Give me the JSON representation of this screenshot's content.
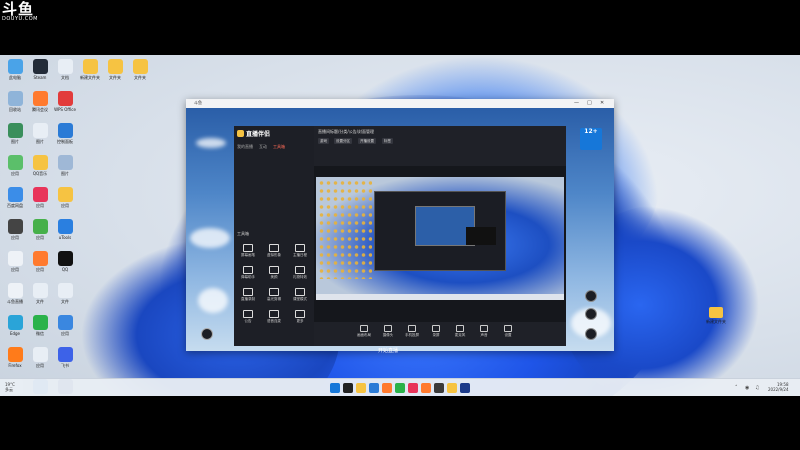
{
  "watermark": {
    "brand": "斗鱼",
    "url": "DOUYU.COM"
  },
  "desktop": {
    "icons": [
      {
        "label": "此电脑",
        "color": "#4aa3e8"
      },
      {
        "label": "Steam",
        "color": "#222b38"
      },
      {
        "label": "文档",
        "color": "#e8eef5"
      },
      {
        "label": "新建文件夹",
        "color": "#f6c342"
      },
      {
        "label": "文件夹",
        "color": "#f6c342"
      },
      {
        "label": "文件夹",
        "color": "#f6c342"
      },
      {
        "label": "回收站",
        "color": "#8fb4d9"
      },
      {
        "label": "腾讯会议",
        "color": "#ff7a2e"
      },
      {
        "label": "WPS Office",
        "color": "#e23b3b"
      },
      {
        "label": "图片",
        "color": "#3a8f5c"
      },
      {
        "label": "图片",
        "color": "#e8eef5"
      },
      {
        "label": "控制面板",
        "color": "#2b7bd6"
      },
      {
        "label": "应用",
        "color": "#5bbf6a"
      },
      {
        "label": "QQ音乐",
        "color": "#f6c342"
      },
      {
        "label": "图片",
        "color": "#9fb8d6"
      },
      {
        "label": "百度网盘",
        "color": "#3b8de8"
      },
      {
        "label": "应用",
        "color": "#e8345a"
      },
      {
        "label": "应用",
        "color": "#f6c342"
      },
      {
        "label": "应用",
        "color": "#444"
      },
      {
        "label": "应用",
        "color": "#46b04a"
      },
      {
        "label": "uTools",
        "color": "#2a7fe0"
      },
      {
        "label": "应用",
        "color": "#eef2f7"
      },
      {
        "label": "应用",
        "color": "#ff7a2e"
      },
      {
        "label": "QQ",
        "color": "#111"
      },
      {
        "label": "斗鱼直播",
        "color": "#eef2f7"
      },
      {
        "label": "文件",
        "color": "#e8eef5"
      },
      {
        "label": "文件",
        "color": "#e8eef5"
      },
      {
        "label": "Edge",
        "color": "#2aa4d8"
      },
      {
        "label": "微信",
        "color": "#2ab24a"
      },
      {
        "label": "应用",
        "color": "#3a87e0"
      },
      {
        "label": "Firefox",
        "color": "#ff7b1a"
      },
      {
        "label": "应用",
        "color": "#e8eef5"
      },
      {
        "label": "飞书",
        "color": "#3d62e8"
      },
      {
        "label": "Google Chrome",
        "color": "#e8eef5"
      },
      {
        "label": "应用",
        "color": "#2a7fe0"
      },
      {
        "label": "应用",
        "color": "#1b3a8a"
      },
      {
        "label": "Microsoft Edge",
        "color": "#1e78d8"
      },
      {
        "label": "Spotify",
        "color": "#1db954"
      },
      {
        "label": "应用",
        "color": "#1b3a8a"
      }
    ],
    "right_folder_label": "新建文件夹"
  },
  "app": {
    "window_title": "斗鱼",
    "logo_text": "直播伴侣",
    "tabs": [
      "我的直播",
      "互动",
      "工具箱"
    ],
    "section_title": "工具箱",
    "tools": [
      "屏幕画笔",
      "虚拟形象",
      "主播日程",
      "弹幕助手",
      "美颜",
      "礼物特效",
      "直播录制",
      "高光剪辑",
      "课堂模式",
      "公告",
      "语音连麦",
      "更多"
    ],
    "room_title": "直播间标题/分类/公告/封面管理",
    "chips": [
      "游戏",
      "设置分区",
      "开播设置",
      "标签"
    ],
    "toolbar": [
      "画面布局",
      "摄像头",
      "手机投屏",
      "录屏",
      "麦克风",
      "声音",
      "设置"
    ],
    "start_label": "开始直播",
    "badge": "12+"
  },
  "taskbar": {
    "weather": "19°C",
    "weather_sub": "多云",
    "time": "19:58",
    "date": "2022/9/24",
    "app_colors": [
      "#1677d9",
      "#222",
      "#f6c342",
      "#2b7bd6",
      "#ff7a2e",
      "#2ab24a",
      "#e8345a",
      "#ff7a2e",
      "#3a3a3a",
      "#f6c342",
      "#1b3a8a"
    ]
  }
}
